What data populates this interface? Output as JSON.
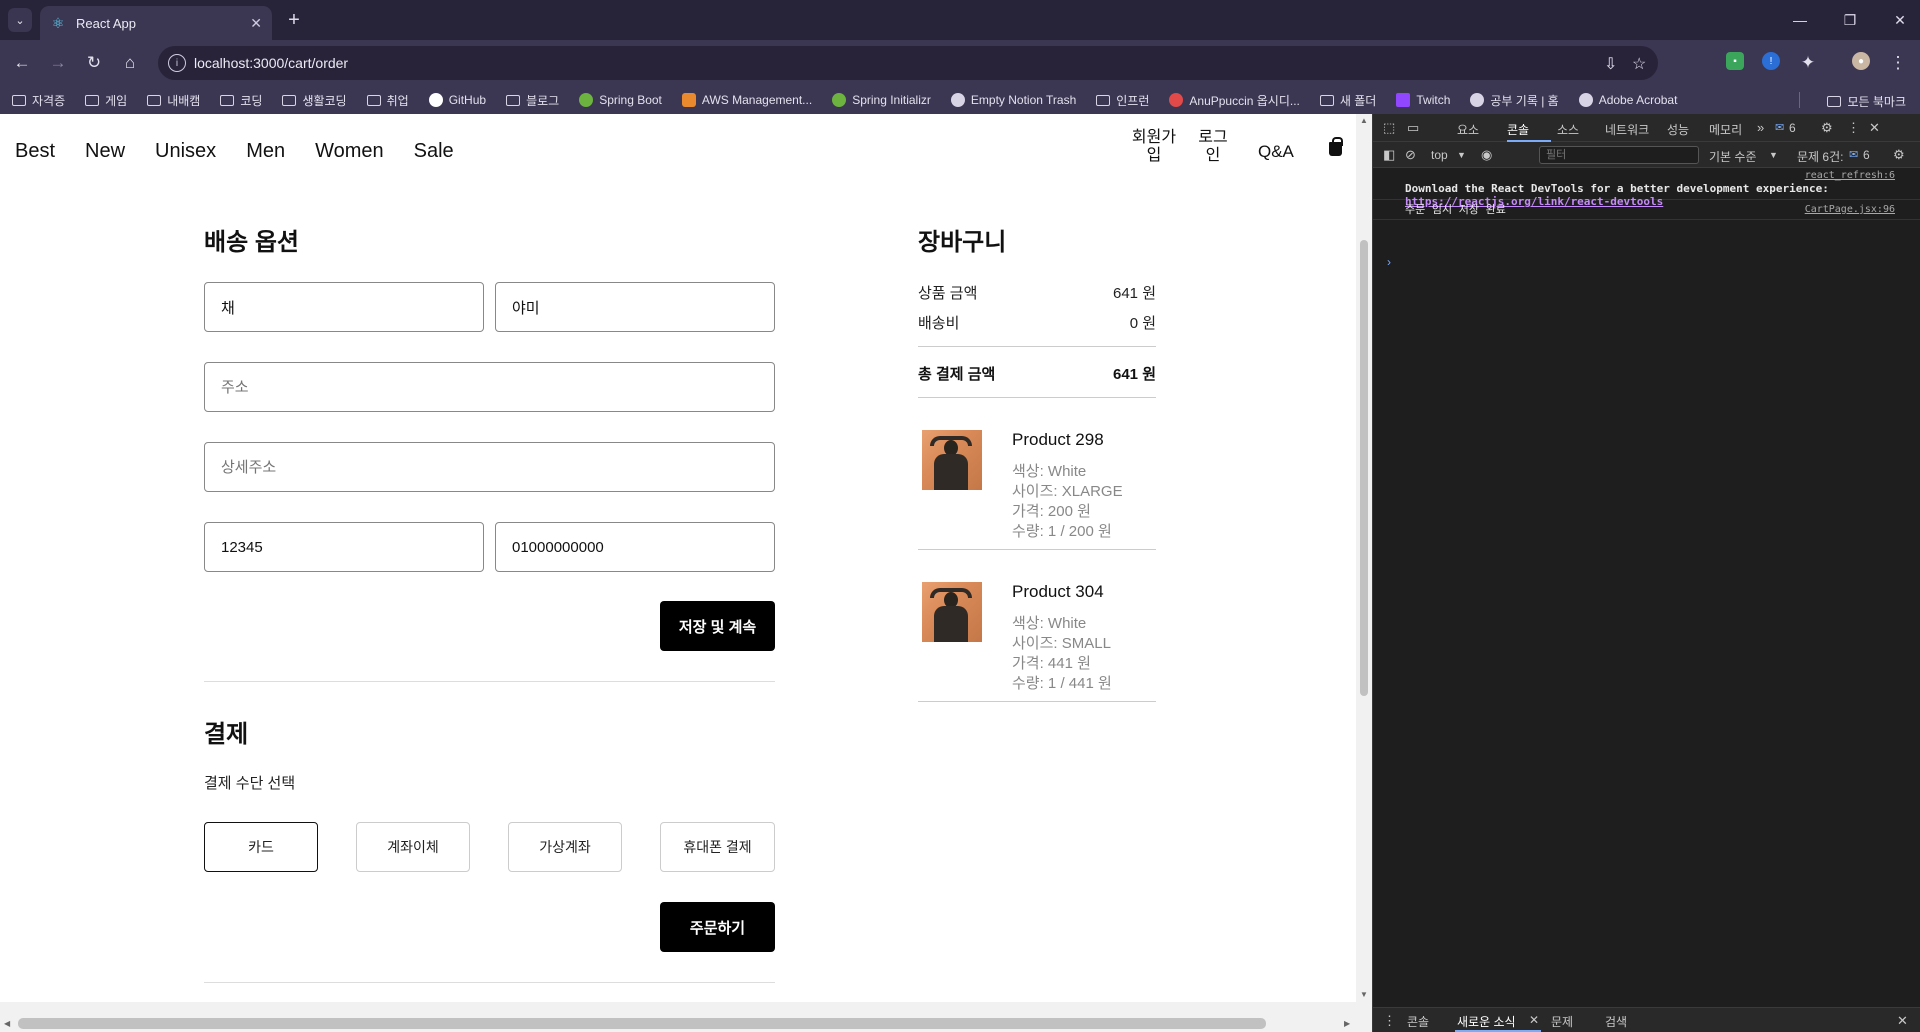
{
  "browser": {
    "tab_title": "React App",
    "url": "localhost:3000/cart/order",
    "bookmarks": [
      {
        "label": "자격증",
        "icon": "folder-icon"
      },
      {
        "label": "게임",
        "icon": "folder-icon"
      },
      {
        "label": "내배캠",
        "icon": "folder-icon"
      },
      {
        "label": "코딩",
        "icon": "folder-icon"
      },
      {
        "label": "생활코딩",
        "icon": "folder-icon"
      },
      {
        "label": "취업",
        "icon": "folder-icon"
      },
      {
        "label": "GitHub",
        "icon": "github-icon"
      },
      {
        "label": "블로그",
        "icon": "folder-icon"
      },
      {
        "label": "Spring Boot",
        "icon": "spring-icon"
      },
      {
        "label": "AWS Management...",
        "icon": "aws-icon"
      },
      {
        "label": "Spring Initializr",
        "icon": "spring-icon"
      },
      {
        "label": "Empty Notion Trash",
        "icon": "notion-icon"
      },
      {
        "label": "인프런",
        "icon": "folder-icon"
      },
      {
        "label": "AnuPpuccin 옵시디...",
        "icon": "obsidian-icon"
      },
      {
        "label": "새 폴더",
        "icon": "folder-icon"
      },
      {
        "label": "Twitch",
        "icon": "twitch-icon"
      },
      {
        "label": "공부 기록 | 홈",
        "icon": "blog-icon"
      },
      {
        "label": "Adobe Acrobat",
        "icon": "acrobat-icon"
      }
    ],
    "all_bookmarks": "모든 북마크"
  },
  "site": {
    "nav": [
      "Best",
      "New",
      "Unisex",
      "Men",
      "Women",
      "Sale"
    ],
    "signup": "회원가입",
    "login": "로그인",
    "qa": "Q&A"
  },
  "shipping": {
    "title": "배송 옵션",
    "first_name": "채",
    "last_name": "야미",
    "address_placeholder": "주소",
    "detail_placeholder": "상세주소",
    "zip": "12345",
    "phone": "01000000000",
    "save_button": "저장 및 계속"
  },
  "payment": {
    "title": "결제",
    "method_label": "결제 수단 선택",
    "methods": [
      "카드",
      "계좌이체",
      "가상계좌",
      "휴대폰 결제"
    ],
    "order_button": "주문하기"
  },
  "cart": {
    "title": "장바구니",
    "subtotal_label": "상품 금액",
    "subtotal_value": "641 원",
    "shipping_label": "배송비",
    "shipping_value": "0 원",
    "total_label": "총 결제 금액",
    "total_value": "641 원",
    "items": [
      {
        "name": "Product 298",
        "color": "색상: White",
        "size": "사이즈: XLARGE",
        "price": "가격: 200 원",
        "qty": "수량: 1 / 200 원"
      },
      {
        "name": "Product 304",
        "color": "색상: White",
        "size": "사이즈: SMALL",
        "price": "가격: 441 원",
        "qty": "수량: 1 / 441 원"
      }
    ]
  },
  "devtools": {
    "tabs": [
      "요소",
      "콘솔",
      "소스",
      "네트워크",
      "성능",
      "메모리"
    ],
    "badge_count": "6",
    "context": "top",
    "filter_placeholder": "필터",
    "level": "기본 수준",
    "issues": "문제 6건:",
    "issues_count": "6",
    "messages": [
      {
        "text_before": "Download the React DevTools for a better development experience: ",
        "link": "https://reactjs.org/link/react-devtools",
        "source": "react_refresh:6"
      },
      {
        "text": "주문 임시 저장 완료",
        "source": "CartPage.jsx:96"
      }
    ],
    "drawer_tabs": [
      "콘솔",
      "새로운 소식",
      "문제",
      "검색"
    ]
  }
}
